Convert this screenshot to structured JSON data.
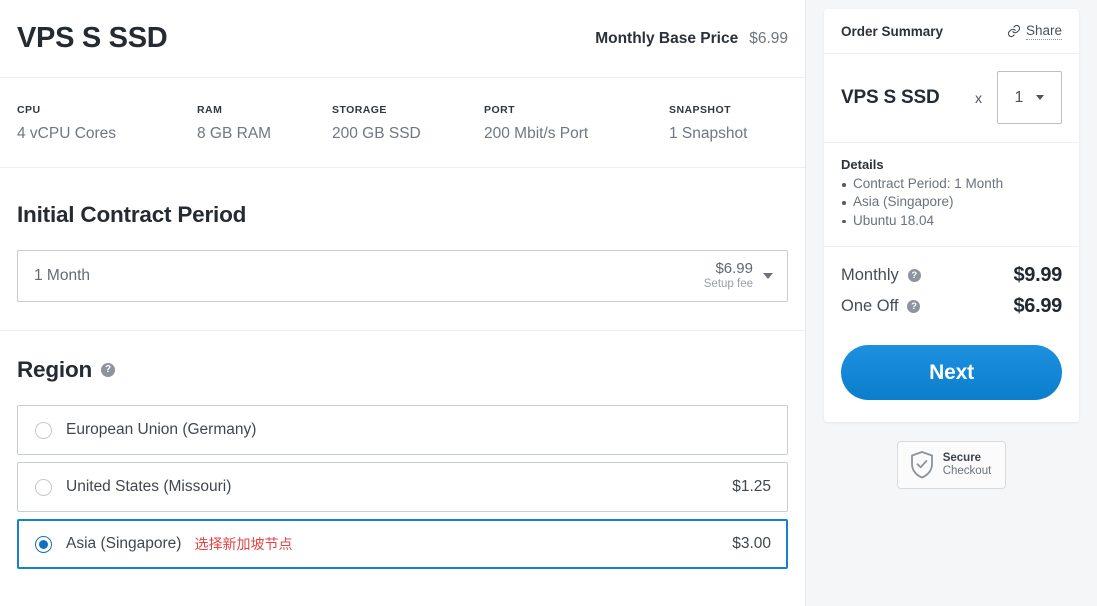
{
  "product": {
    "title": "VPS S SSD",
    "price_label": "Monthly Base Price",
    "price_value": "$6.99",
    "specs": [
      {
        "label": "CPU",
        "value": "4 vCPU Cores"
      },
      {
        "label": "RAM",
        "value": "8 GB RAM"
      },
      {
        "label": "STORAGE",
        "value": "200 GB SSD"
      },
      {
        "label": "PORT",
        "value": "200 Mbit/s Port"
      },
      {
        "label": "SNAPSHOT",
        "value": "1 Snapshot"
      }
    ]
  },
  "contract": {
    "heading": "Initial Contract Period",
    "selected": "1 Month",
    "fee_amount": "$6.99",
    "fee_label": "Setup fee"
  },
  "region": {
    "heading": "Region",
    "help_glyph": "?",
    "options": [
      {
        "label": "European Union (Germany)",
        "price": "",
        "note": "",
        "selected": false
      },
      {
        "label": "United States (Missouri)",
        "price": "$1.25",
        "note": "",
        "selected": false
      },
      {
        "label": "Asia (Singapore)",
        "price": "$3.00",
        "note": "选择新加坡节点",
        "selected": true
      }
    ]
  },
  "summary": {
    "title": "Order Summary",
    "share_label": "Share",
    "item_name": "VPS S SSD",
    "multiply_symbol": "x",
    "quantity": "1",
    "details_title": "Details",
    "details": [
      "Contract Period: 1 Month",
      "Asia (Singapore)",
      "Ubuntu 18.04"
    ],
    "totals": [
      {
        "label": "Monthly",
        "value": "$9.99"
      },
      {
        "label": "One Off",
        "value": "$6.99"
      }
    ],
    "next_label": "Next",
    "secure_line1": "Secure",
    "secure_line2": "Checkout"
  },
  "colors": {
    "accent": "#1582d0",
    "button": "#0b7ecb",
    "note_red": "#e24444",
    "page_bg": "#f5f6f8"
  }
}
